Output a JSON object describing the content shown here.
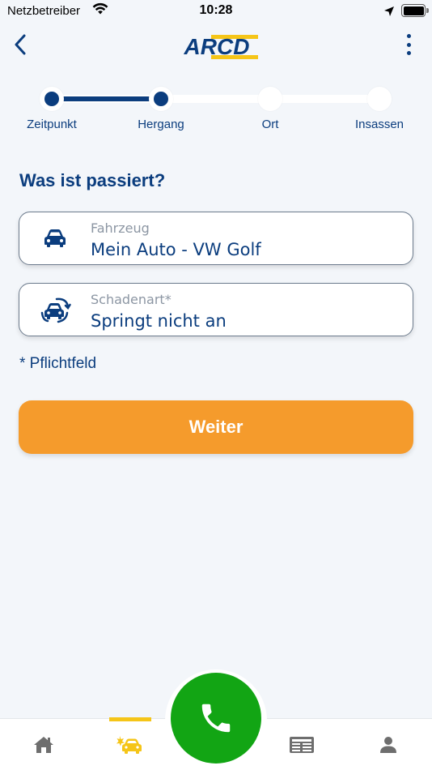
{
  "status_bar": {
    "carrier": "Netzbetreiber",
    "time": "10:28"
  },
  "header": {
    "logo_text": "ARCD"
  },
  "stepper": {
    "steps": [
      {
        "label": "Zeitpunkt",
        "done": true
      },
      {
        "label": "Hergang",
        "done": true
      },
      {
        "label": "Ort",
        "done": false
      },
      {
        "label": "Insassen",
        "done": false
      }
    ]
  },
  "form": {
    "heading": "Was ist passiert?",
    "vehicle": {
      "label": "Fahrzeug",
      "value": "Mein Auto - VW Golf"
    },
    "damage_type": {
      "label": "Schadenart*",
      "value": "Springt nicht an"
    },
    "required_note": "* Pflichtfeld",
    "submit_label": "Weiter"
  },
  "tab_bar": {
    "tabs": [
      "home-icon",
      "car-accident-icon",
      "phone-icon",
      "news-icon",
      "profile-icon"
    ],
    "active_index": 1
  },
  "colors": {
    "brand_blue": "#0b3d7e",
    "accent_orange": "#f59b2c",
    "call_green": "#12a514",
    "indicator_yellow": "#f5c518"
  }
}
